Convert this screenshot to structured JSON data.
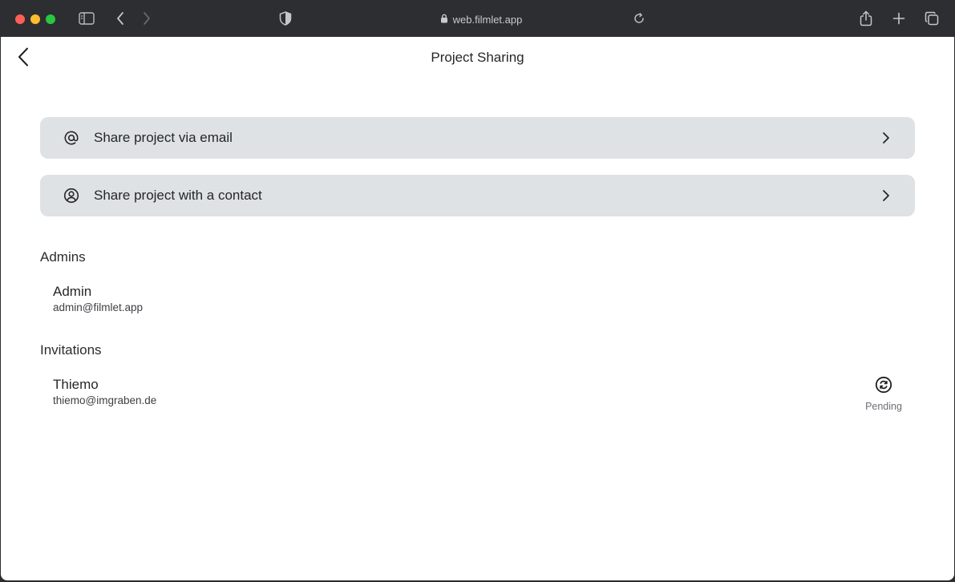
{
  "browser": {
    "url": "web.filmlet.app",
    "icons": {
      "sidebar": "sidebar-icon",
      "back": "chevron-left-icon",
      "forward": "chevron-right-icon",
      "shield": "shield-icon",
      "lock": "lock-icon",
      "reload": "reload-icon",
      "share": "share-icon",
      "new_tab": "plus-icon",
      "tabs": "tabs-overview-icon"
    }
  },
  "header": {
    "title": "Project Sharing"
  },
  "actions": [
    {
      "label": "Share project via email",
      "icon": "at-icon"
    },
    {
      "label": "Share project with a contact",
      "icon": "user-circle-icon"
    }
  ],
  "admins": {
    "heading": "Admins",
    "items": [
      {
        "name": "Admin",
        "email": "admin@filmlet.app"
      }
    ]
  },
  "invitations": {
    "heading": "Invitations",
    "items": [
      {
        "name": "Thiemo",
        "email": "thiemo@imgraben.de",
        "status": "Pending",
        "status_icon": "pending-sync-icon"
      }
    ]
  },
  "colors": {
    "chrome": "#2c2e31",
    "action_bg": "#dfe2e5",
    "text": "#25272a"
  }
}
